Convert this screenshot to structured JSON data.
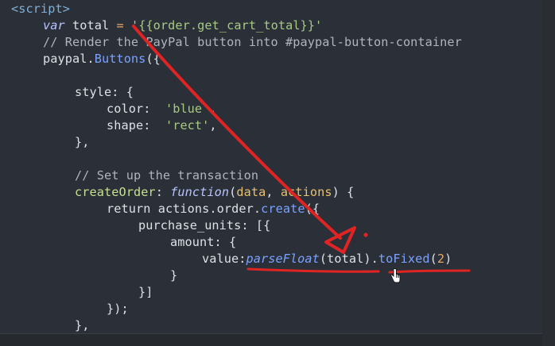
{
  "editor": {
    "lines": [
      {
        "tokens": [
          [
            "tag",
            "<script>"
          ]
        ]
      },
      {
        "tokens": [
          [
            "kw",
            "var"
          ],
          [
            "op",
            " total "
          ],
          [
            "eq",
            "="
          ],
          [
            "op",
            " "
          ],
          [
            "str",
            "'{{order.get_cart_total}}'"
          ]
        ]
      },
      {
        "tokens": [
          [
            "cm",
            "// Render the PayPal button into #paypal-button-container"
          ]
        ]
      },
      {
        "tokens": [
          [
            "op",
            "paypal."
          ],
          [
            "fn",
            "Buttons"
          ],
          [
            "op",
            "({"
          ]
        ]
      },
      {
        "tokens": [
          [
            "op",
            ""
          ]
        ]
      },
      {
        "tokens": [
          [
            "op",
            "style: {"
          ]
        ]
      },
      {
        "tokens": [
          [
            "op",
            "color:  "
          ],
          [
            "str",
            "'blue'"
          ],
          [
            "op",
            ","
          ]
        ]
      },
      {
        "tokens": [
          [
            "op",
            "shape:  "
          ],
          [
            "str",
            "'rect'"
          ],
          [
            "op",
            ","
          ]
        ]
      },
      {
        "tokens": [
          [
            "op",
            "},"
          ]
        ]
      },
      {
        "tokens": [
          [
            "op",
            ""
          ]
        ]
      },
      {
        "tokens": [
          [
            "cm",
            "// Set up the transaction"
          ]
        ]
      },
      {
        "tokens": [
          [
            "prop",
            "createOrder"
          ],
          [
            "op",
            ": "
          ],
          [
            "kw",
            "function"
          ],
          [
            "op",
            "("
          ],
          [
            "param",
            "data"
          ],
          [
            "op",
            ", "
          ],
          [
            "param",
            "actions"
          ],
          [
            "op",
            ") {"
          ]
        ]
      },
      {
        "tokens": [
          [
            "op",
            "return actions.order."
          ],
          [
            "fn",
            "create"
          ],
          [
            "op",
            "({"
          ]
        ]
      },
      {
        "tokens": [
          [
            "op",
            "purchase_units: [{"
          ]
        ]
      },
      {
        "tokens": [
          [
            "op",
            "amount: {"
          ]
        ]
      },
      {
        "tokens": [
          [
            "op",
            "value:"
          ],
          [
            "fn-i",
            "parseFloat"
          ],
          [
            "op",
            "(total)."
          ],
          [
            "fn",
            "toFixed"
          ],
          [
            "op",
            "("
          ],
          [
            "num",
            "2"
          ],
          [
            "op",
            ")"
          ]
        ]
      },
      {
        "tokens": [
          [
            "op",
            "}"
          ]
        ]
      },
      {
        "tokens": [
          [
            "op",
            "}]"
          ]
        ]
      },
      {
        "tokens": [
          [
            "op",
            "});"
          ]
        ]
      },
      {
        "tokens": [
          [
            "op",
            "},"
          ]
        ]
      }
    ]
  },
  "annotation": {
    "color": "#e02424"
  },
  "cursor": {
    "icon": "hand-pointer-icon"
  }
}
